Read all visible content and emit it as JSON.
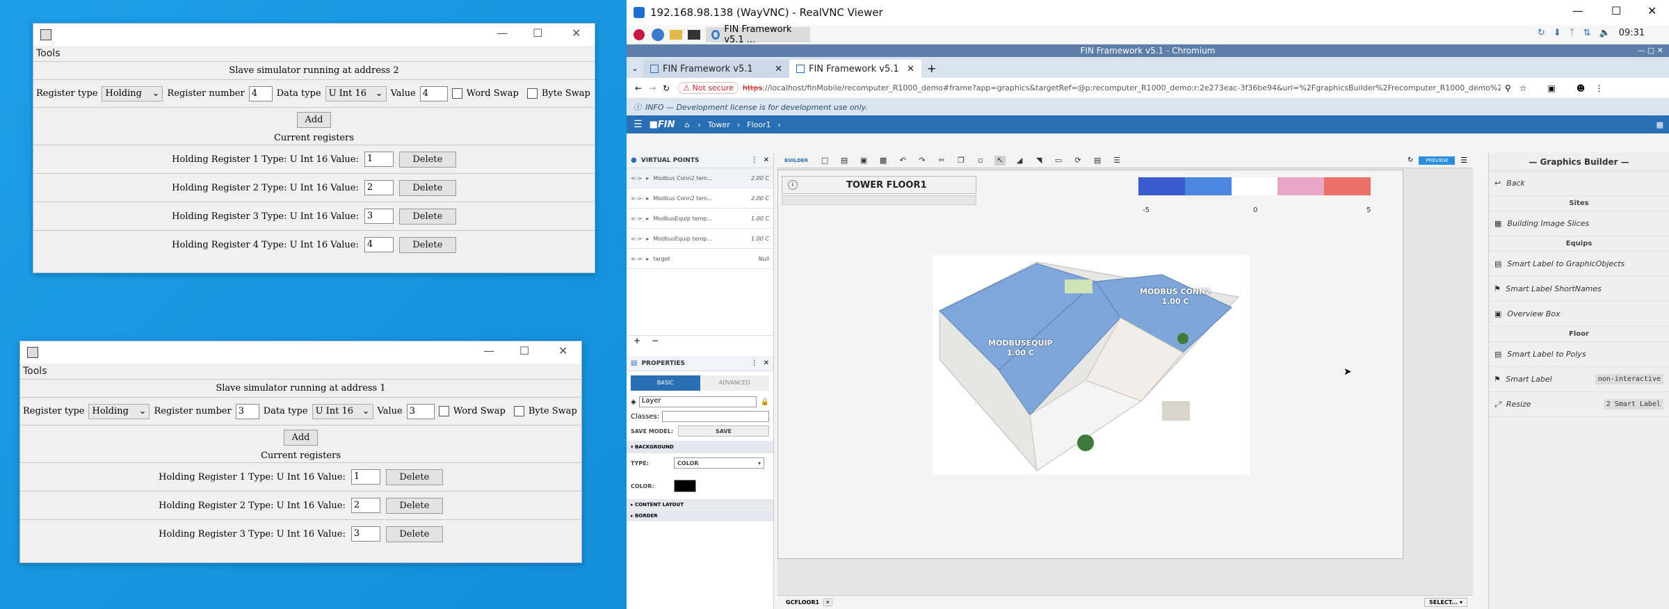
{
  "sim2": {
    "menu": "Tools",
    "status": "Slave simulator running at address 2",
    "register_type_label": "Register type",
    "register_type_value": "Holding",
    "register_number_label": "Register number",
    "register_number_value": "4",
    "data_type_label": "Data type",
    "data_type_value": "U Int 16",
    "value_label": "Value",
    "value_value": "4",
    "word_swap": "Word Swap",
    "byte_swap": "Byte Swap",
    "add": "Add",
    "current": "Current registers",
    "rows": [
      {
        "label": "Holding Register 1 Type: U Int 16 Value:",
        "value": "1",
        "delete": "Delete"
      },
      {
        "label": "Holding Register 2 Type: U Int 16 Value:",
        "value": "2",
        "delete": "Delete"
      },
      {
        "label": "Holding Register 3 Type: U Int 16 Value:",
        "value": "3",
        "delete": "Delete"
      },
      {
        "label": "Holding Register 4 Type: U Int 16 Value:",
        "value": "4",
        "delete": "Delete"
      }
    ]
  },
  "sim1": {
    "menu": "Tools",
    "status": "Slave simulator running at address 1",
    "register_type_label": "Register type",
    "register_type_value": "Holding",
    "register_number_label": "Register number",
    "register_number_value": "3",
    "data_type_label": "Data type",
    "data_type_value": "U Int 16",
    "value_label": "Value",
    "value_value": "3",
    "word_swap": "Word Swap",
    "byte_swap": "Byte Swap",
    "add": "Add",
    "current": "Current registers",
    "rows": [
      {
        "label": "Holding Register 1 Type: U Int 16 Value:",
        "value": "1",
        "delete": "Delete"
      },
      {
        "label": "Holding Register 2 Type: U Int 16 Value:",
        "value": "2",
        "delete": "Delete"
      },
      {
        "label": "Holding Register 3 Type: U Int 16 Value:",
        "value": "3",
        "delete": "Delete"
      }
    ]
  },
  "vnc": {
    "title": "192.168.98.138 (WayVNC) - RealVNC Viewer",
    "taskbar_app": "FIN Framework v5.1 ...",
    "clock": "09:31",
    "chromium_title": "FIN Framework v5.1 - Chromium",
    "tabs": [
      "FIN Framework v5.1",
      "FIN Framework v5.1"
    ],
    "not_secure": "Not secure",
    "url_https": "https",
    "url_rest": "://localhost/finMobile/recomputer_R1000_demo#frame?app=graphics&targetRef=@p:recomputer_R1000_demo:r:2e273eac-3f36be94&uri=%2FgraphicsBuilder%2Frecomputer_R1000_demo%2F%23targetRef%3D%40p%3Are...",
    "info": "INFO — Development license is for development use only.",
    "breadcrumb": [
      "Tower",
      "Floor1"
    ],
    "virtual_points_title": "VIRTUAL POINTS",
    "virtual_points": [
      {
        "name": "Modbus Conn2 tem...",
        "value": "2.00 C"
      },
      {
        "name": "Modbus Conn2 tem...",
        "value": "2.00 C"
      },
      {
        "name": "ModbusEquip temp...",
        "value": "1.00 C"
      },
      {
        "name": "ModbusEquip temp...",
        "value": "1.00 C"
      },
      {
        "name": "target",
        "value": "Null"
      }
    ],
    "properties_title": "PROPERTIES",
    "basic": "BASIC",
    "advanced": "ADVANCED",
    "layer": "Layer",
    "classes_label": "Classes:",
    "save_model_label": "SAVE MODEL:",
    "save": "SAVE",
    "background": "BACKGROUND",
    "type_label": "TYPE:",
    "type_value": "COLOR",
    "color_label": "COLOR:",
    "content_layout": "CONTENT LAYOUT",
    "border": "BORDER",
    "builder_label": "BUILDER",
    "preview": "PREVIEW",
    "canvas_title": "TOWER FLOOR1",
    "scale_ticks": [
      "-5",
      "0",
      "5"
    ],
    "label_conn2": "MODBUS CONN2",
    "label_conn2_val": "1.00 C",
    "label_equip": "MODBUSEQUIP",
    "label_equip_val": "1.00 C",
    "bottom_tab": "GCFLOOR1",
    "select": "SELECT...",
    "gb_title": "— Graphics Builder —",
    "gb_back": "Back",
    "gb_sites": "Sites",
    "gb_building_image_slices": "Building Image Slices",
    "gb_equips": "Equips",
    "gb_smart_label_go": "Smart Label to GraphicObjects",
    "gb_smart_label_short": "Smart Label ShortNames",
    "gb_overview_box": "Overview Box",
    "gb_floor": "Floor",
    "gb_smart_label_polys": "Smart Label to Polys",
    "gb_smart_label": "Smart Label",
    "gb_non_interactive": "non-interactive",
    "gb_resize": "Resize",
    "gb_2_smart_label": "2 Smart Label"
  },
  "colors": {
    "desktop": "#1592dc",
    "fin_blue": "#2a6fb4",
    "scale": [
      "#3a5bd0",
      "#4a86e0",
      "#ffffff",
      "#e8a5c6",
      "#e87068"
    ]
  }
}
